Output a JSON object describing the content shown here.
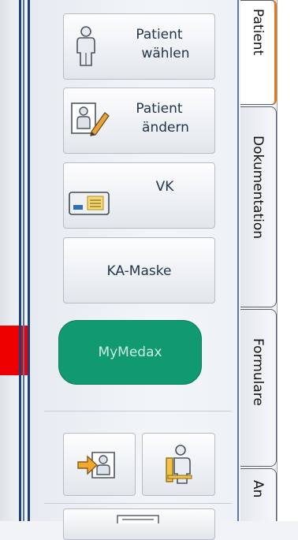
{
  "toolbar": {
    "patient_waehlen": [
      "Patient",
      "wählen"
    ],
    "patient_aendern": [
      "Patient",
      "ändern"
    ],
    "vk": "VK",
    "ka_maske": "KA-Maske",
    "mymedax": "MyMedax"
  },
  "tabs": [
    {
      "label": "Patient",
      "active": true
    },
    {
      "label": "Dokumentation",
      "active": false
    },
    {
      "label": "Formulare",
      "active": false
    },
    {
      "label": "An",
      "active": false
    }
  ],
  "icons": {
    "patient_waehlen": "person-icon",
    "patient_aendern": "edit-person-icon",
    "vk": "insurance-card-icon",
    "bottom_left": "transfer-person-icon",
    "bottom_right": "seated-person-icon",
    "bottom_partial": "list-icon"
  },
  "colors": {
    "frame_blue": "#1d3f7a",
    "mymedax_green": "#119a6f",
    "marker_red": "#ee0000",
    "active_tab_accent": "#e07b1a"
  }
}
